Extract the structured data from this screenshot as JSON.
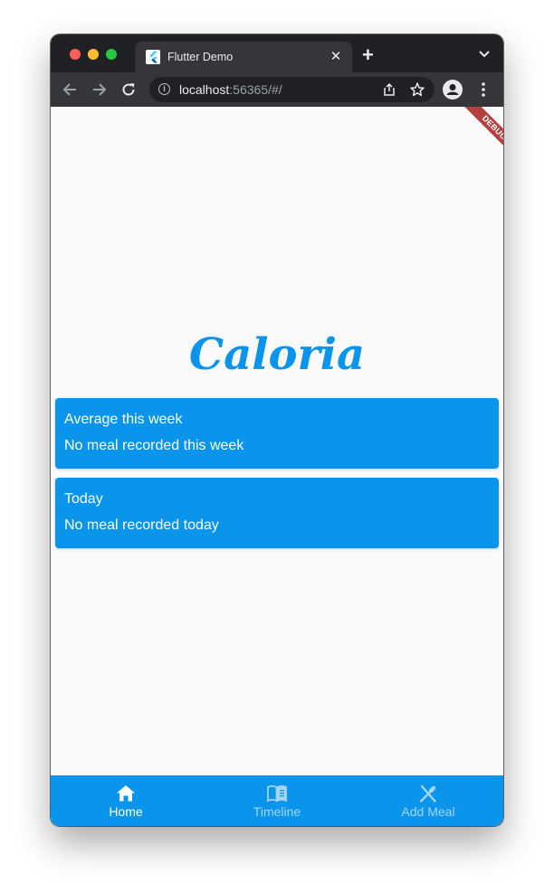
{
  "browser": {
    "tab_title": "Flutter Demo",
    "url_host": "localhost",
    "url_rest": ":56365/#/"
  },
  "app": {
    "debug_label": "DEBUG",
    "logo_text": "Caloria",
    "accent_color": "#0895eb",
    "cards": [
      {
        "title": "Average this week",
        "body": "No meal recorded this week"
      },
      {
        "title": "Today",
        "body": "No meal recorded today"
      }
    ],
    "bottom_nav": [
      {
        "label": "Home",
        "icon": "home-icon",
        "active": true
      },
      {
        "label": "Timeline",
        "icon": "book-icon",
        "active": false
      },
      {
        "label": "Add Meal",
        "icon": "utensils-icon",
        "active": false
      }
    ]
  }
}
